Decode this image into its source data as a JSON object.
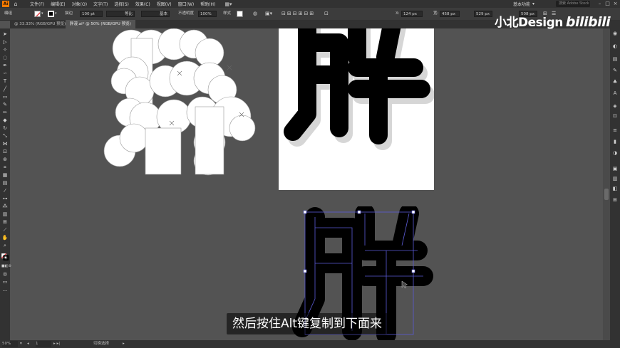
{
  "app": {
    "logo_text": "Ai",
    "home_icon": "home-icon"
  },
  "menu": [
    "文件(F)",
    "编辑(E)",
    "对象(O)",
    "文字(T)",
    "选择(S)",
    "效果(C)",
    "视图(V)",
    "窗口(W)",
    "帮助(H)"
  ],
  "menubar_right": {
    "workspace": "基本功能",
    "search_placeholder": "搜索 Adobe Stock"
  },
  "control_bar": {
    "object_type": "编组",
    "stroke_label": "描边",
    "stroke_weight": "100 pt",
    "profile_label": "等比",
    "brush_label": "基本",
    "opacity_label": "不透明度",
    "opacity_value": "100%",
    "style_label": "样式",
    "x_label": "X:",
    "x_value": "124 px",
    "w_label": "宽:",
    "w_value": "458 px",
    "y_value": "529 px",
    "h_value": "508 px"
  },
  "tabs": [
    {
      "label": "@ 33.33% (RGB/GPU 预览)",
      "active": false
    },
    {
      "label": "胖漫.ai* @ 50% (RGB/GPU 预览)",
      "active": true
    }
  ],
  "status": {
    "zoom": "50%",
    "page": "1",
    "tool_label": "切换选择"
  },
  "watermark": {
    "text": "小北Design",
    "brand": "bilibili"
  },
  "subtitle": "然后按住Alt键复制到下面来",
  "colors": {
    "accent": "#ff7c00",
    "ui_dark": "#323232",
    "canvas": "#535353",
    "selection": "#5b5bd6",
    "stroke_red": "#e0262b"
  }
}
